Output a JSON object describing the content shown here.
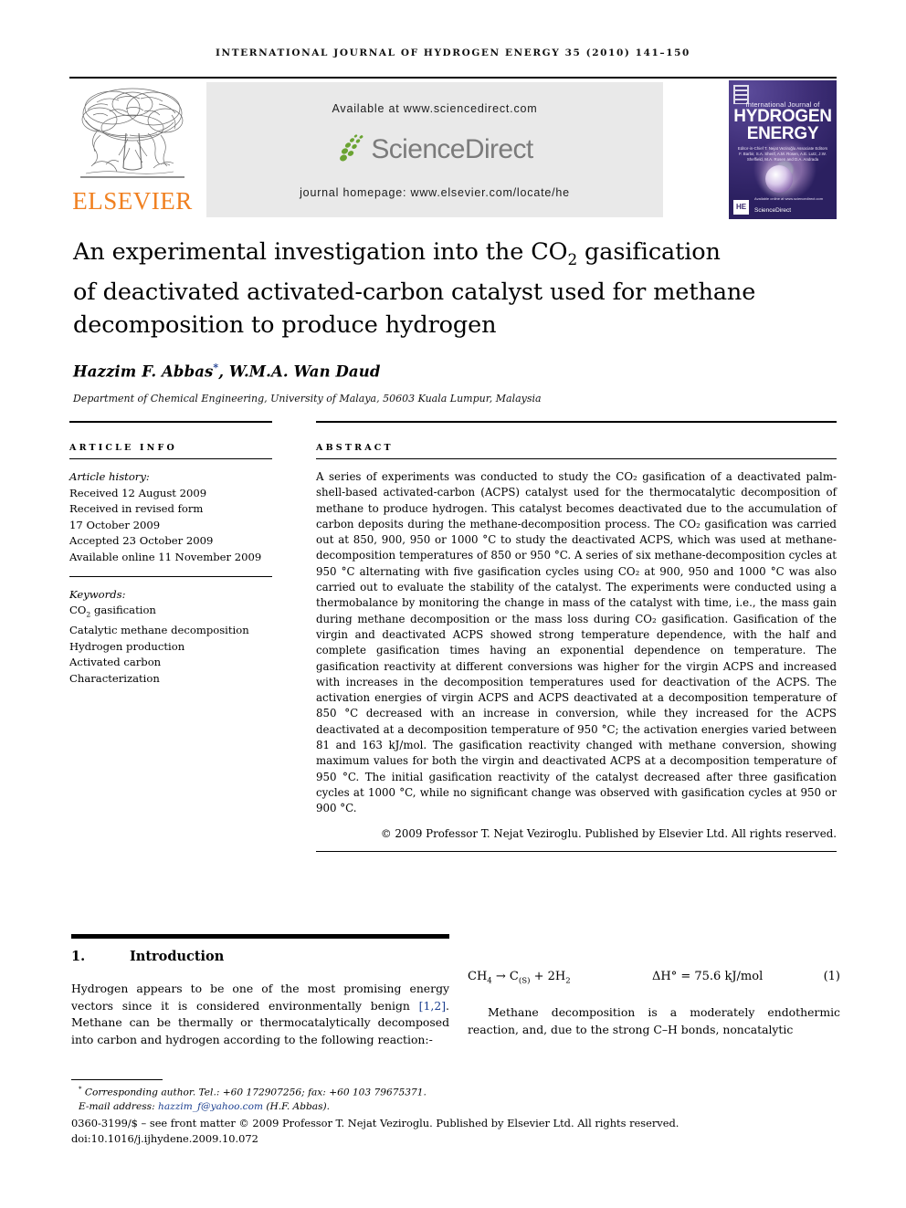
{
  "running_head": "International Journal of Hydrogen Energy 35 (2010) 141–150",
  "masthead": {
    "publisher_word": "ELSEVIER",
    "tree_icon": "elsevier-tree-icon",
    "available_at": "Available at www.sciencedirect.com",
    "sciencedirect_word": "ScienceDirect",
    "sciencedirect_leaf_icon": "sciencedirect-leaf-icon",
    "journal_homepage": "journal homepage: www.elsevier.com/locate/he",
    "cover": {
      "eyebrow": "International Journal of",
      "line1": "HYDROGEN",
      "line2": "ENERGY",
      "editors": "Editor-in-Chief  T. Nejat Veziroğlu   Associate Editors  F. Barbir, S.A. Sherif, A.M. Rosen, A.E. Lutz, J.W. Sheffield, M.A. Rosen and D.A. Andrada",
      "badge_he": "HE",
      "sciencedirect_small": "ScienceDirect",
      "sciencedirect_tagline": "Available online at www.sciencedirect.com"
    }
  },
  "article": {
    "title_line1_a": "An experimental investigation into the CO",
    "title_line1_sub": "2",
    "title_line1_b": " gasification",
    "title_line2": "of deactivated activated-carbon catalyst used for methane",
    "title_line3": "decomposition to produce hydrogen",
    "authors": "Hazzim F. Abbas",
    "author_star": "*",
    "authors_rest": ", W.M.A. Wan Daud",
    "affiliation": "Department of Chemical Engineering, University of Malaya, 50603 Kuala Lumpur, Malaysia"
  },
  "article_info": {
    "heading": "ARTICLE INFO",
    "history_label": "Article history:",
    "history": [
      "Received 12 August 2009",
      "Received in revised form",
      "17 October 2009",
      "Accepted 23 October 2009",
      "Available online 11 November 2009"
    ],
    "keywords_label": "Keywords:",
    "keywords": [
      "CO2 gasification",
      "Catalytic methane decomposition",
      "Hydrogen production",
      "Activated carbon",
      "Characterization"
    ]
  },
  "abstract": {
    "heading": "ABSTRACT",
    "text": "A series of experiments was conducted to study the CO₂ gasification of a deactivated palm-shell-based activated-carbon (ACPS) catalyst used for the thermocatalytic decomposition of methane to produce hydrogen. This catalyst becomes deactivated due to the accumulation of carbon deposits during the methane-decomposition process. The CO₂ gasification was carried out at 850, 900, 950 or 1000 °C to study the deactivated ACPS, which was used at methane-decomposition temperatures of 850 or 950 °C. A series of six methane-decomposition cycles at 950 °C alternating with five gasification cycles using CO₂ at 900, 950 and 1000 °C was also carried out to evaluate the stability of the catalyst. The experiments were conducted using a thermobalance by monitoring the change in mass of the catalyst with time, i.e., the mass gain during methane decomposition or the mass loss during CO₂ gasification. Gasification of the virgin and deactivated ACPS showed strong temperature dependence, with the half and complete gasification times having an exponential dependence on temperature. The gasification reactivity at different conversions was higher for the virgin ACPS and increased with increases in the decomposition temperatures used for deactivation of the ACPS. The activation energies of virgin ACPS and ACPS deactivated at a decomposition temperature of 850 °C decreased with an increase in conversion, while they increased for the ACPS deactivated at a decomposition temperature of 950 °C; the activation energies varied between 81 and 163 kJ/mol. The gasification reactivity changed with methane conversion, showing maximum values for both the virgin and deactivated ACPS at a decomposition temperature of 950 °C. The initial gasification reactivity of the catalyst decreased after three gasification cycles at 1000 °C, while no significant change was observed with gasification cycles at 950 or 900 °C.",
    "copyright": "© 2009 Professor T. Nejat Veziroglu. Published by Elsevier Ltd. All rights reserved."
  },
  "body": {
    "section_number": "1.",
    "section_title": "Introduction",
    "para1_a": "Hydrogen appears to be one of the most promising energy vectors since it is considered environmentally benign ",
    "para1_ref": "[1,2]",
    "para1_b": ". Methane can be thermally or thermocatalytically decomposed into carbon and hydrogen according to the following reaction:-",
    "equation_lhs": "CH₄ → C₍ₛ₎ + 2H₂",
    "equation_enthalpy": "ΔH° = 75.6 kJ/mol",
    "equation_number": "(1)",
    "para2": "Methane decomposition is a moderately endothermic reaction, and, due to the strong C–H bonds, noncatalytic"
  },
  "footnotes": {
    "corresponding_marker": "*",
    "corresponding": "Corresponding author. Tel.: +60 172907256; fax: +60 103 79675371.",
    "email_label": "E-mail address: ",
    "email": "hazzim_f@yahoo.com",
    "email_owner": " (H.F. Abbas).",
    "issn_line": "0360-3199/$ – see front matter © 2009 Professor T. Nejat Veziroglu. Published by Elsevier Ltd. All rights reserved.",
    "doi_line": "doi:10.1016/j.ijhydene.2009.10.072"
  },
  "colors": {
    "elsevier_orange": "#f08020",
    "link_blue": "#1b3f8f",
    "sciencedirect_green": "#6aa331",
    "sciencedirect_grey": "#7b7b7b",
    "banner_grey": "#e9e9e9"
  }
}
